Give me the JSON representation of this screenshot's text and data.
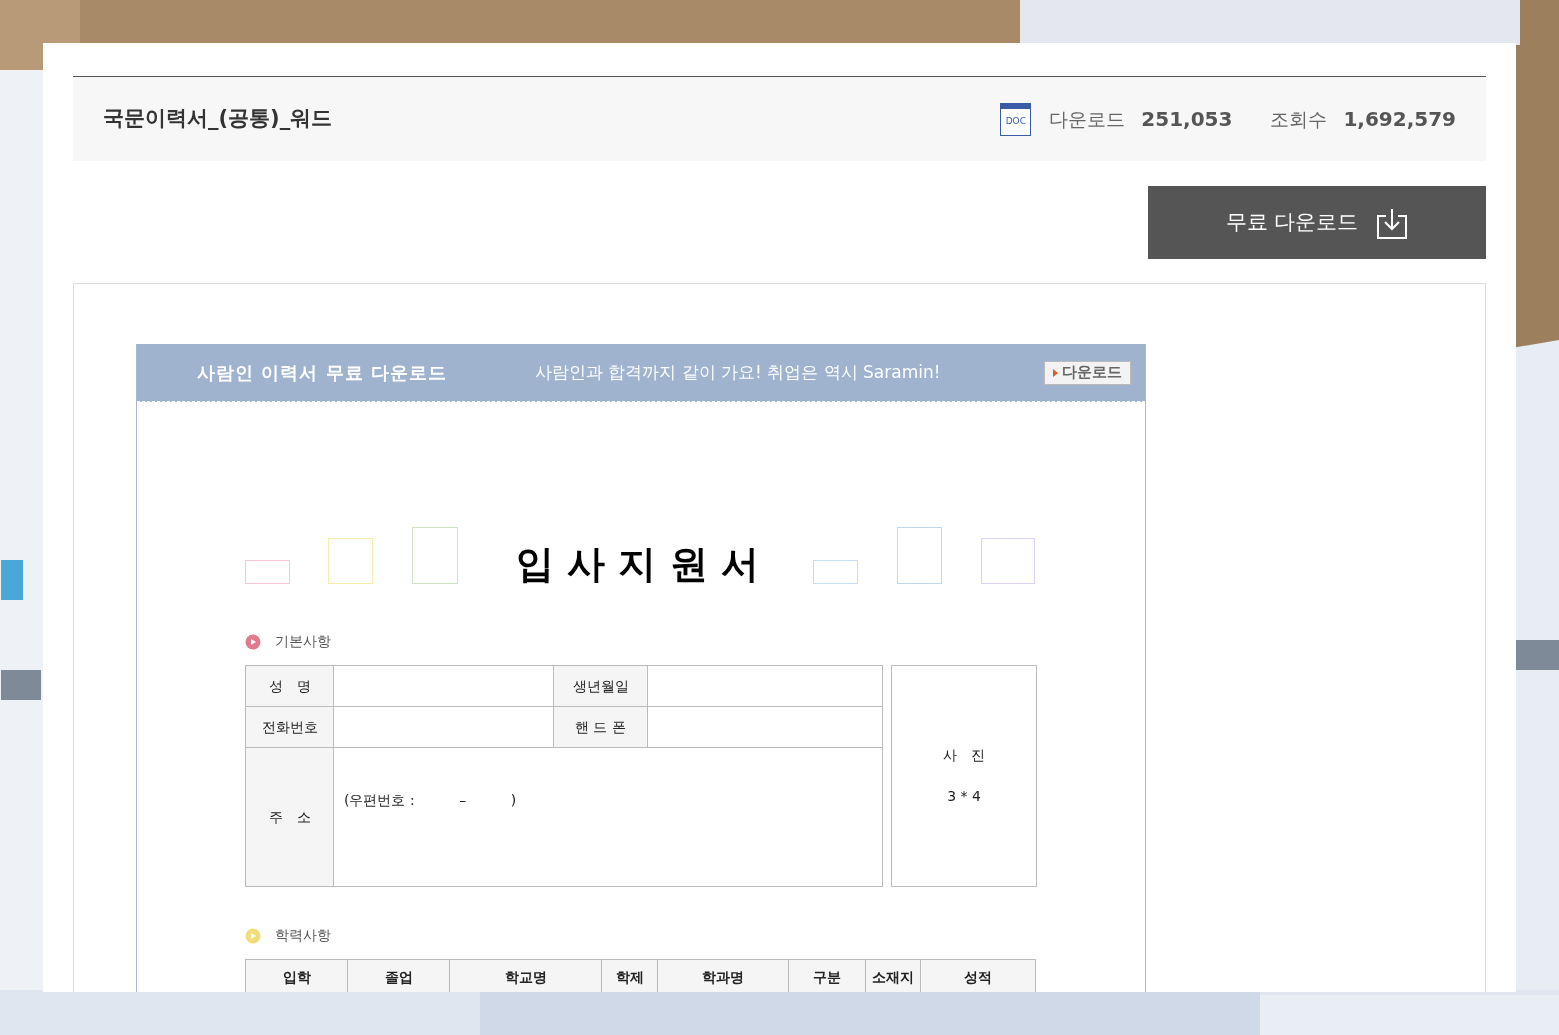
{
  "document": {
    "title": "국문이력서_(공통)_워드",
    "file_type": "DOC",
    "download_label": "다운로드",
    "download_count": "251,053",
    "views_label": "조회수",
    "views_count": "1,692,579"
  },
  "download_button": {
    "label": "무료 다운로드"
  },
  "preview": {
    "banner": {
      "title": "사람인 이력서 무료 다운로드",
      "slogan": "사람인과 합격까지 같이 가요! 취업은 역시 Saramin!",
      "button": "다운로드"
    },
    "form_title": "입 사 지 원 서",
    "sections": [
      {
        "title": "기본사항",
        "color": "#e07a8e",
        "kind": "personal",
        "rows": [
          [
            "성　명",
            "",
            "생년월일",
            ""
          ],
          [
            "전화번호",
            "",
            "핸 드 폰",
            ""
          ]
        ],
        "address_label": "주　소",
        "address_value": "(우편번호 :          –          )",
        "photo": [
          "사　진",
          "3 * 4"
        ]
      },
      {
        "title": "학력사항",
        "color": "#f0dc78",
        "kind": "table",
        "columns": [
          "입학",
          "졸업",
          "학교명",
          "학제",
          "학과명",
          "구분",
          "소재지",
          "성적"
        ]
      }
    ]
  }
}
